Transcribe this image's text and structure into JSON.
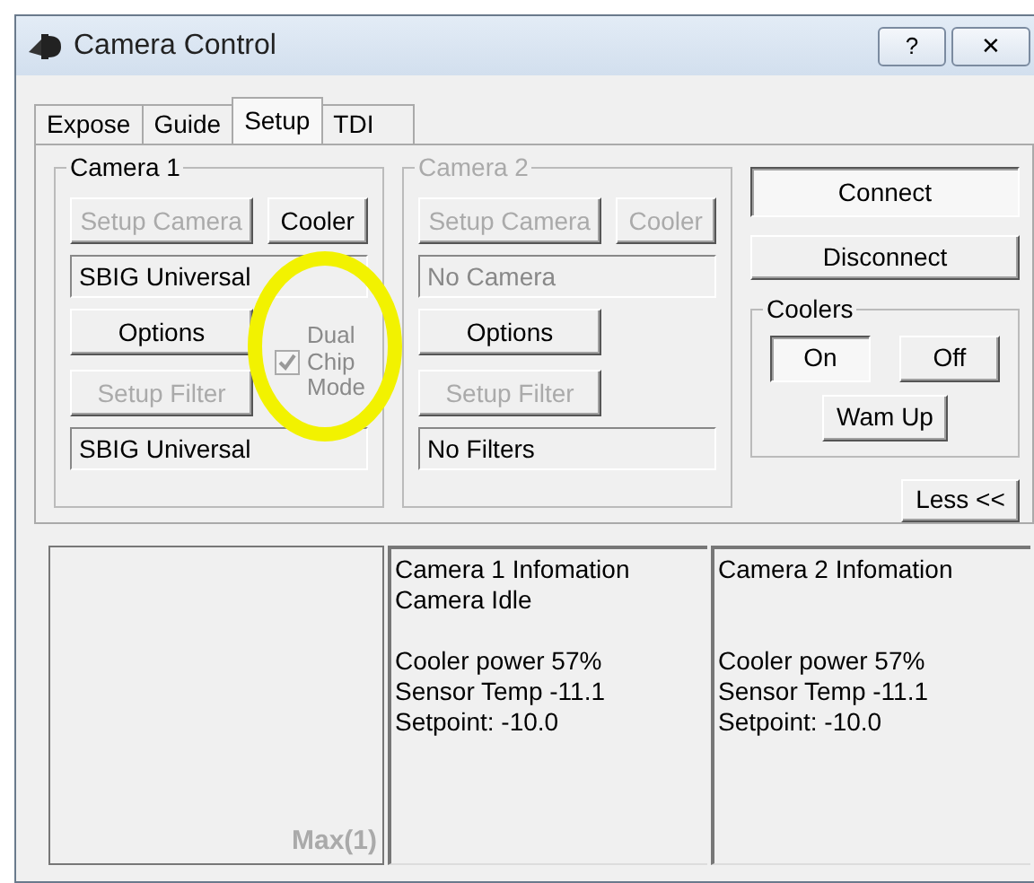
{
  "window": {
    "title": "Camera Control",
    "buttons": [
      {
        "kind": "help",
        "label": "?"
      },
      {
        "kind": "close",
        "label": "✕"
      }
    ]
  },
  "tabs": [
    {
      "label": "Expose",
      "selected": false
    },
    {
      "label": "Guide",
      "selected": false
    },
    {
      "label": "Setup",
      "selected": true
    },
    {
      "label": "TDI",
      "selected": false
    }
  ],
  "cameras": [
    {
      "title": "Camera 1",
      "disabled": false,
      "setup_camera": {
        "label": "Setup Camera",
        "disabled": true
      },
      "cooler": {
        "label": "Cooler",
        "disabled": false
      },
      "camera_field": {
        "value": "SBIG Universal",
        "disabled": false
      },
      "options": {
        "label": "Options",
        "disabled": false
      },
      "setup_filter": {
        "label": "Setup Filter",
        "disabled": true
      },
      "filter_field": {
        "value": "SBIG Universal",
        "disabled": false
      },
      "dual_chip": {
        "label": "Dual Chip Mode",
        "checked": true,
        "disabled": true
      }
    },
    {
      "title": "Camera 2",
      "disabled": true,
      "setup_camera": {
        "label": "Setup Camera",
        "disabled": true
      },
      "cooler": {
        "label": "Cooler",
        "disabled": true
      },
      "camera_field": {
        "value": "No Camera",
        "disabled": true
      },
      "options": {
        "label": "Options",
        "disabled": false
      },
      "setup_filter": {
        "label": "Setup Filter",
        "disabled": true
      },
      "filter_field": {
        "value": "No Filters",
        "disabled": false
      }
    }
  ],
  "connect": {
    "label": "Connect",
    "pressed": true
  },
  "disconnect": {
    "label": "Disconnect",
    "pressed": false
  },
  "coolers": {
    "title": "Coolers",
    "buttons": [
      {
        "label": "On",
        "pressed": true
      },
      {
        "label": "Off",
        "pressed": false
      }
    ],
    "warm_up": {
      "label": "Wam Up",
      "pressed": false
    }
  },
  "less": {
    "label": "Less <<",
    "pressed": false
  },
  "preview": {
    "label": "Max(1)"
  },
  "info": [
    {
      "title": "Camera 1 Infomation",
      "status": "Camera Idle",
      "details": [
        "Cooler power 57%",
        "Sensor Temp -11.1",
        "Setpoint: -10.0"
      ]
    },
    {
      "title": "Camera 2 Infomation",
      "details": [
        "Cooler power 57%",
        "Sensor Temp -11.1",
        "Setpoint: -10.0"
      ]
    }
  ]
}
